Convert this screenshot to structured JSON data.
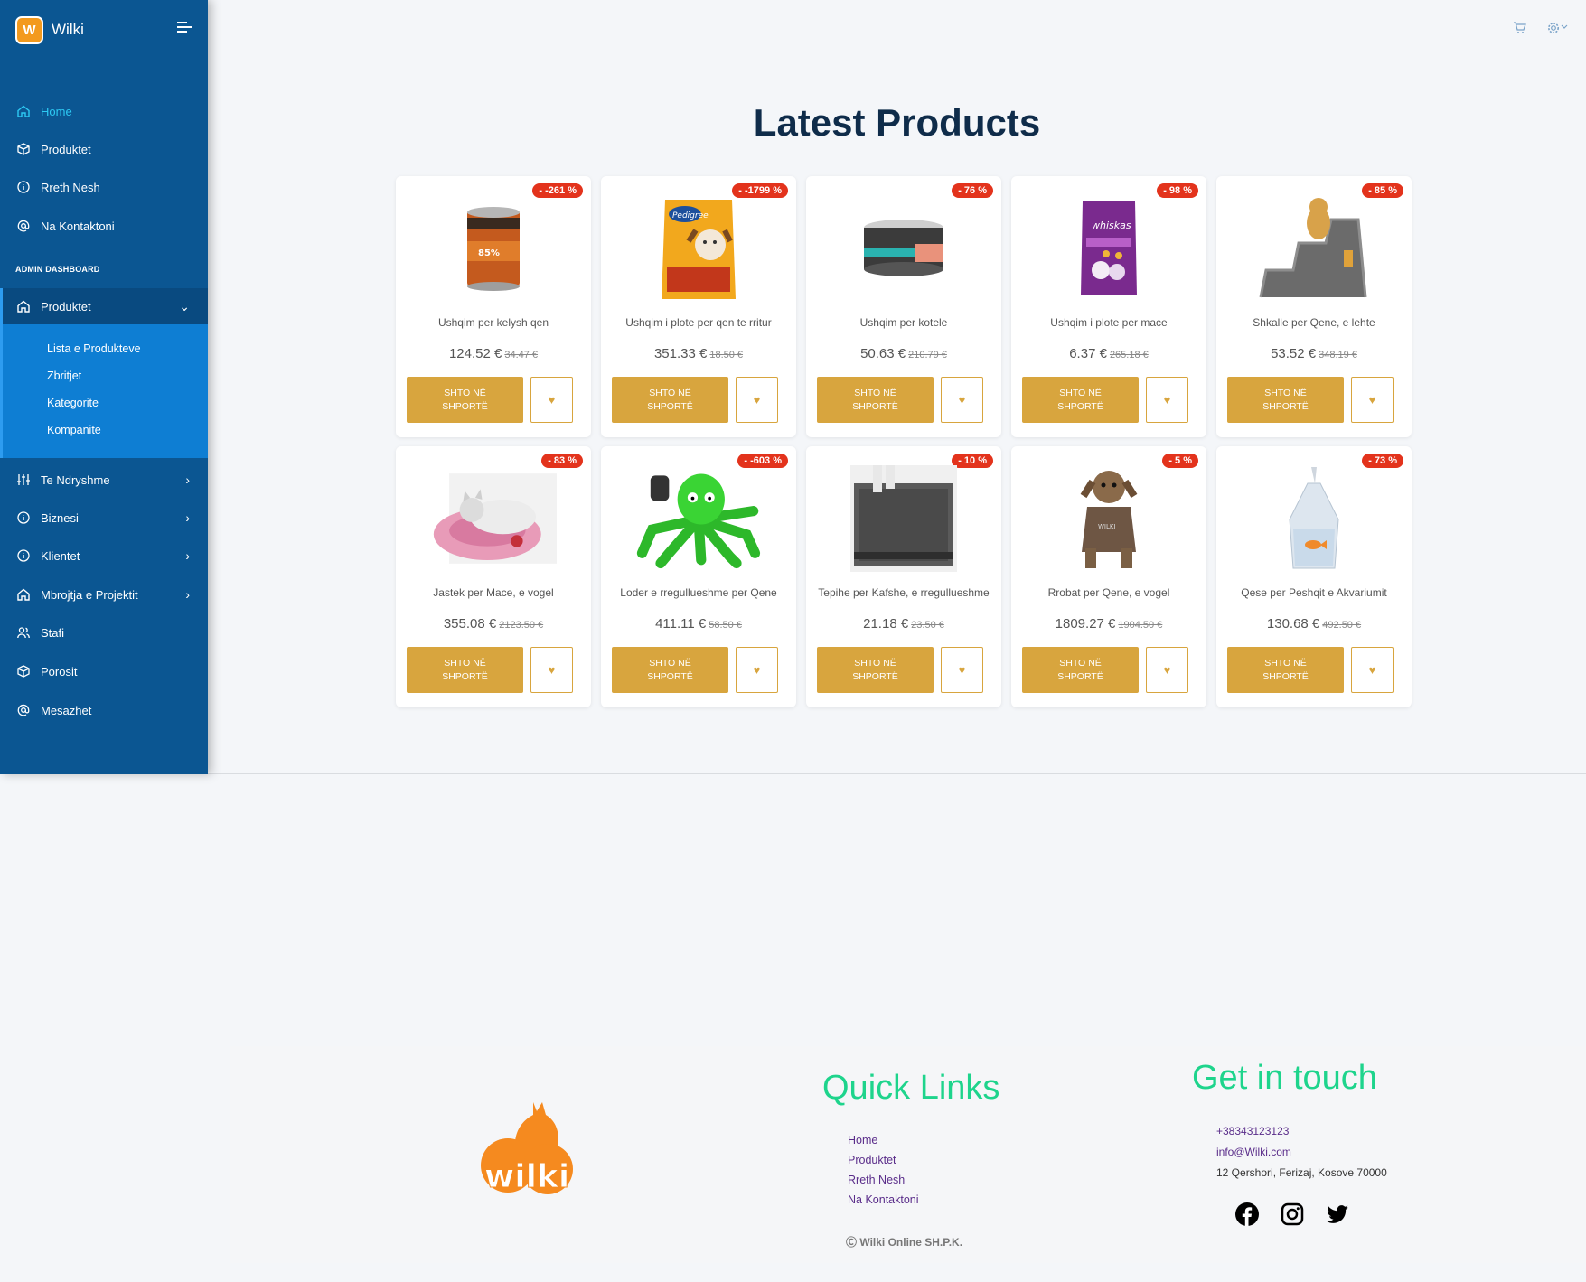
{
  "brand": {
    "name": "Wilki",
    "logo_letter": "W"
  },
  "sidebar": {
    "items": [
      {
        "label": "Home",
        "icon": "home-icon"
      },
      {
        "label": "Produktet",
        "icon": "box-icon"
      },
      {
        "label": "Rreth Nesh",
        "icon": "info-icon"
      },
      {
        "label": "Na Kontaktoni",
        "icon": "at-icon"
      }
    ],
    "section_title": "ADMIN DASHBOARD",
    "admin_items": [
      {
        "label": "Produktet",
        "icon": "home-icon"
      },
      {
        "label": "Te Ndryshme",
        "icon": "sliders-icon"
      },
      {
        "label": "Biznesi",
        "icon": "info-icon"
      },
      {
        "label": "Klientet",
        "icon": "info-icon"
      },
      {
        "label": "Mbrojtja e Projektit",
        "icon": "home-icon"
      },
      {
        "label": "Stafi",
        "icon": "users-icon"
      },
      {
        "label": "Porosit",
        "icon": "box-icon"
      },
      {
        "label": "Mesazhet",
        "icon": "at-icon"
      }
    ],
    "submenu": [
      "Lista e Produkteve",
      "Zbritjet",
      "Kategorite",
      "Kompanite"
    ]
  },
  "header": {
    "cart_icon": "cart-icon",
    "settings_icon": "gear-icon"
  },
  "main": {
    "title": "Latest Products",
    "add_to_cart_label": "SHTO NË SHPORTË",
    "products": [
      {
        "name": "Ushqim per kelysh qen",
        "price": "124.52 €",
        "old_price": "34.47 €",
        "discount": "- -261 %"
      },
      {
        "name": "Ushqim i plote per qen te rritur",
        "price": "351.33 €",
        "old_price": "18.50 €",
        "discount": "- -1799 %"
      },
      {
        "name": "Ushqim per kotele",
        "price": "50.63 €",
        "old_price": "210.79 €",
        "discount": "- 76 %"
      },
      {
        "name": "Ushqim i plote per mace",
        "price": "6.37 €",
        "old_price": "265.18 €",
        "discount": "- 98 %"
      },
      {
        "name": "Shkalle per Qene, e lehte",
        "price": "53.52 €",
        "old_price": "348.19 €",
        "discount": "- 85 %"
      },
      {
        "name": "Jastek per Mace, e vogel",
        "price": "355.08 €",
        "old_price": "2123.50 €",
        "discount": "- 83 %"
      },
      {
        "name": "Loder e rregullueshme per Qene",
        "price": "411.11 €",
        "old_price": "58.50 €",
        "discount": "- -603 %"
      },
      {
        "name": "Tepihe per Kafshe, e rregullueshme",
        "price": "21.18 €",
        "old_price": "23.50 €",
        "discount": "- 10 %"
      },
      {
        "name": "Rrobat per Qene, e vogel",
        "price": "1809.27 €",
        "old_price": "1904.50 €",
        "discount": "- 5 %"
      },
      {
        "name": "Qese per Peshqit e Akvariumit",
        "price": "130.68 €",
        "old_price": "492.50 €",
        "discount": "- 73 %"
      }
    ]
  },
  "footer": {
    "logo_text": "wilki",
    "quick_links_title": "Quick Links",
    "quick_links": [
      "Home",
      "Produktet",
      "Rreth Nesh",
      "Na Kontaktoni"
    ],
    "get_in_touch_title": "Get in touch",
    "phone": "+38343123123",
    "email": "info@Wilki.com",
    "address": "12 Qershori, Ferizaj, Kosove 70000",
    "copyright": "Wilki Online SH.P.K.",
    "social": [
      "facebook-icon",
      "instagram-icon",
      "twitter-icon"
    ]
  },
  "colors": {
    "sidebar": "#0b5692",
    "accent_button": "#d8a53e",
    "badge": "#e3331c",
    "footer_heading": "#1ed48c"
  }
}
